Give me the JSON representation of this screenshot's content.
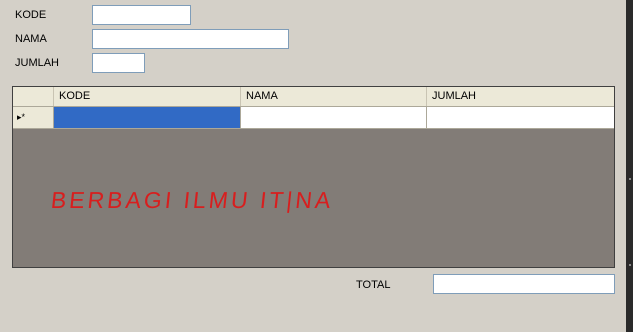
{
  "form": {
    "kode_label": "KODE",
    "nama_label": "NAMA",
    "jumlah_label": "JUMLAH",
    "kode_value": "",
    "nama_value": "",
    "jumlah_value": "",
    "total_label": "TOTAL",
    "total_value": ""
  },
  "grid": {
    "columns": [
      "KODE",
      "NAMA",
      "JUMLAH"
    ],
    "new_row_marker": "▸*",
    "new_row": [
      "",
      "",
      ""
    ],
    "selection_color": "#316ac5",
    "empty_area_color": "#827c77"
  },
  "watermark": "BERBAGI ILMU IT|NA"
}
